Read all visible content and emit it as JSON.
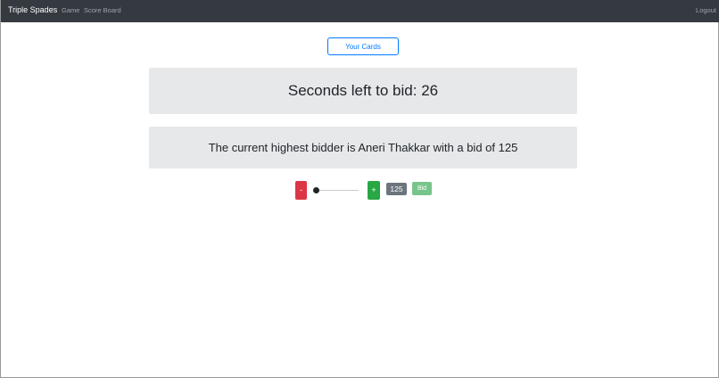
{
  "navbar": {
    "brand": "Triple Spades",
    "links": [
      "Game",
      "Score Board"
    ],
    "logout": "Logout"
  },
  "main": {
    "your_cards_button": "Your Cards",
    "timer_text": "Seconds left to bid: 26",
    "bidder_text": "The current highest bidder is Aneri Thakkar with a bid of 125"
  },
  "bid_controls": {
    "minus_label": "-",
    "plus_label": "+",
    "bid_value": "125",
    "bid_button": "Bid",
    "slider_level": 0
  },
  "colors": {
    "navbar": "#343a40",
    "primary": "#007bff",
    "danger": "#dc3545",
    "success": "#28a745",
    "secondary": "#6c757d",
    "panel": "#e6e8ea"
  }
}
